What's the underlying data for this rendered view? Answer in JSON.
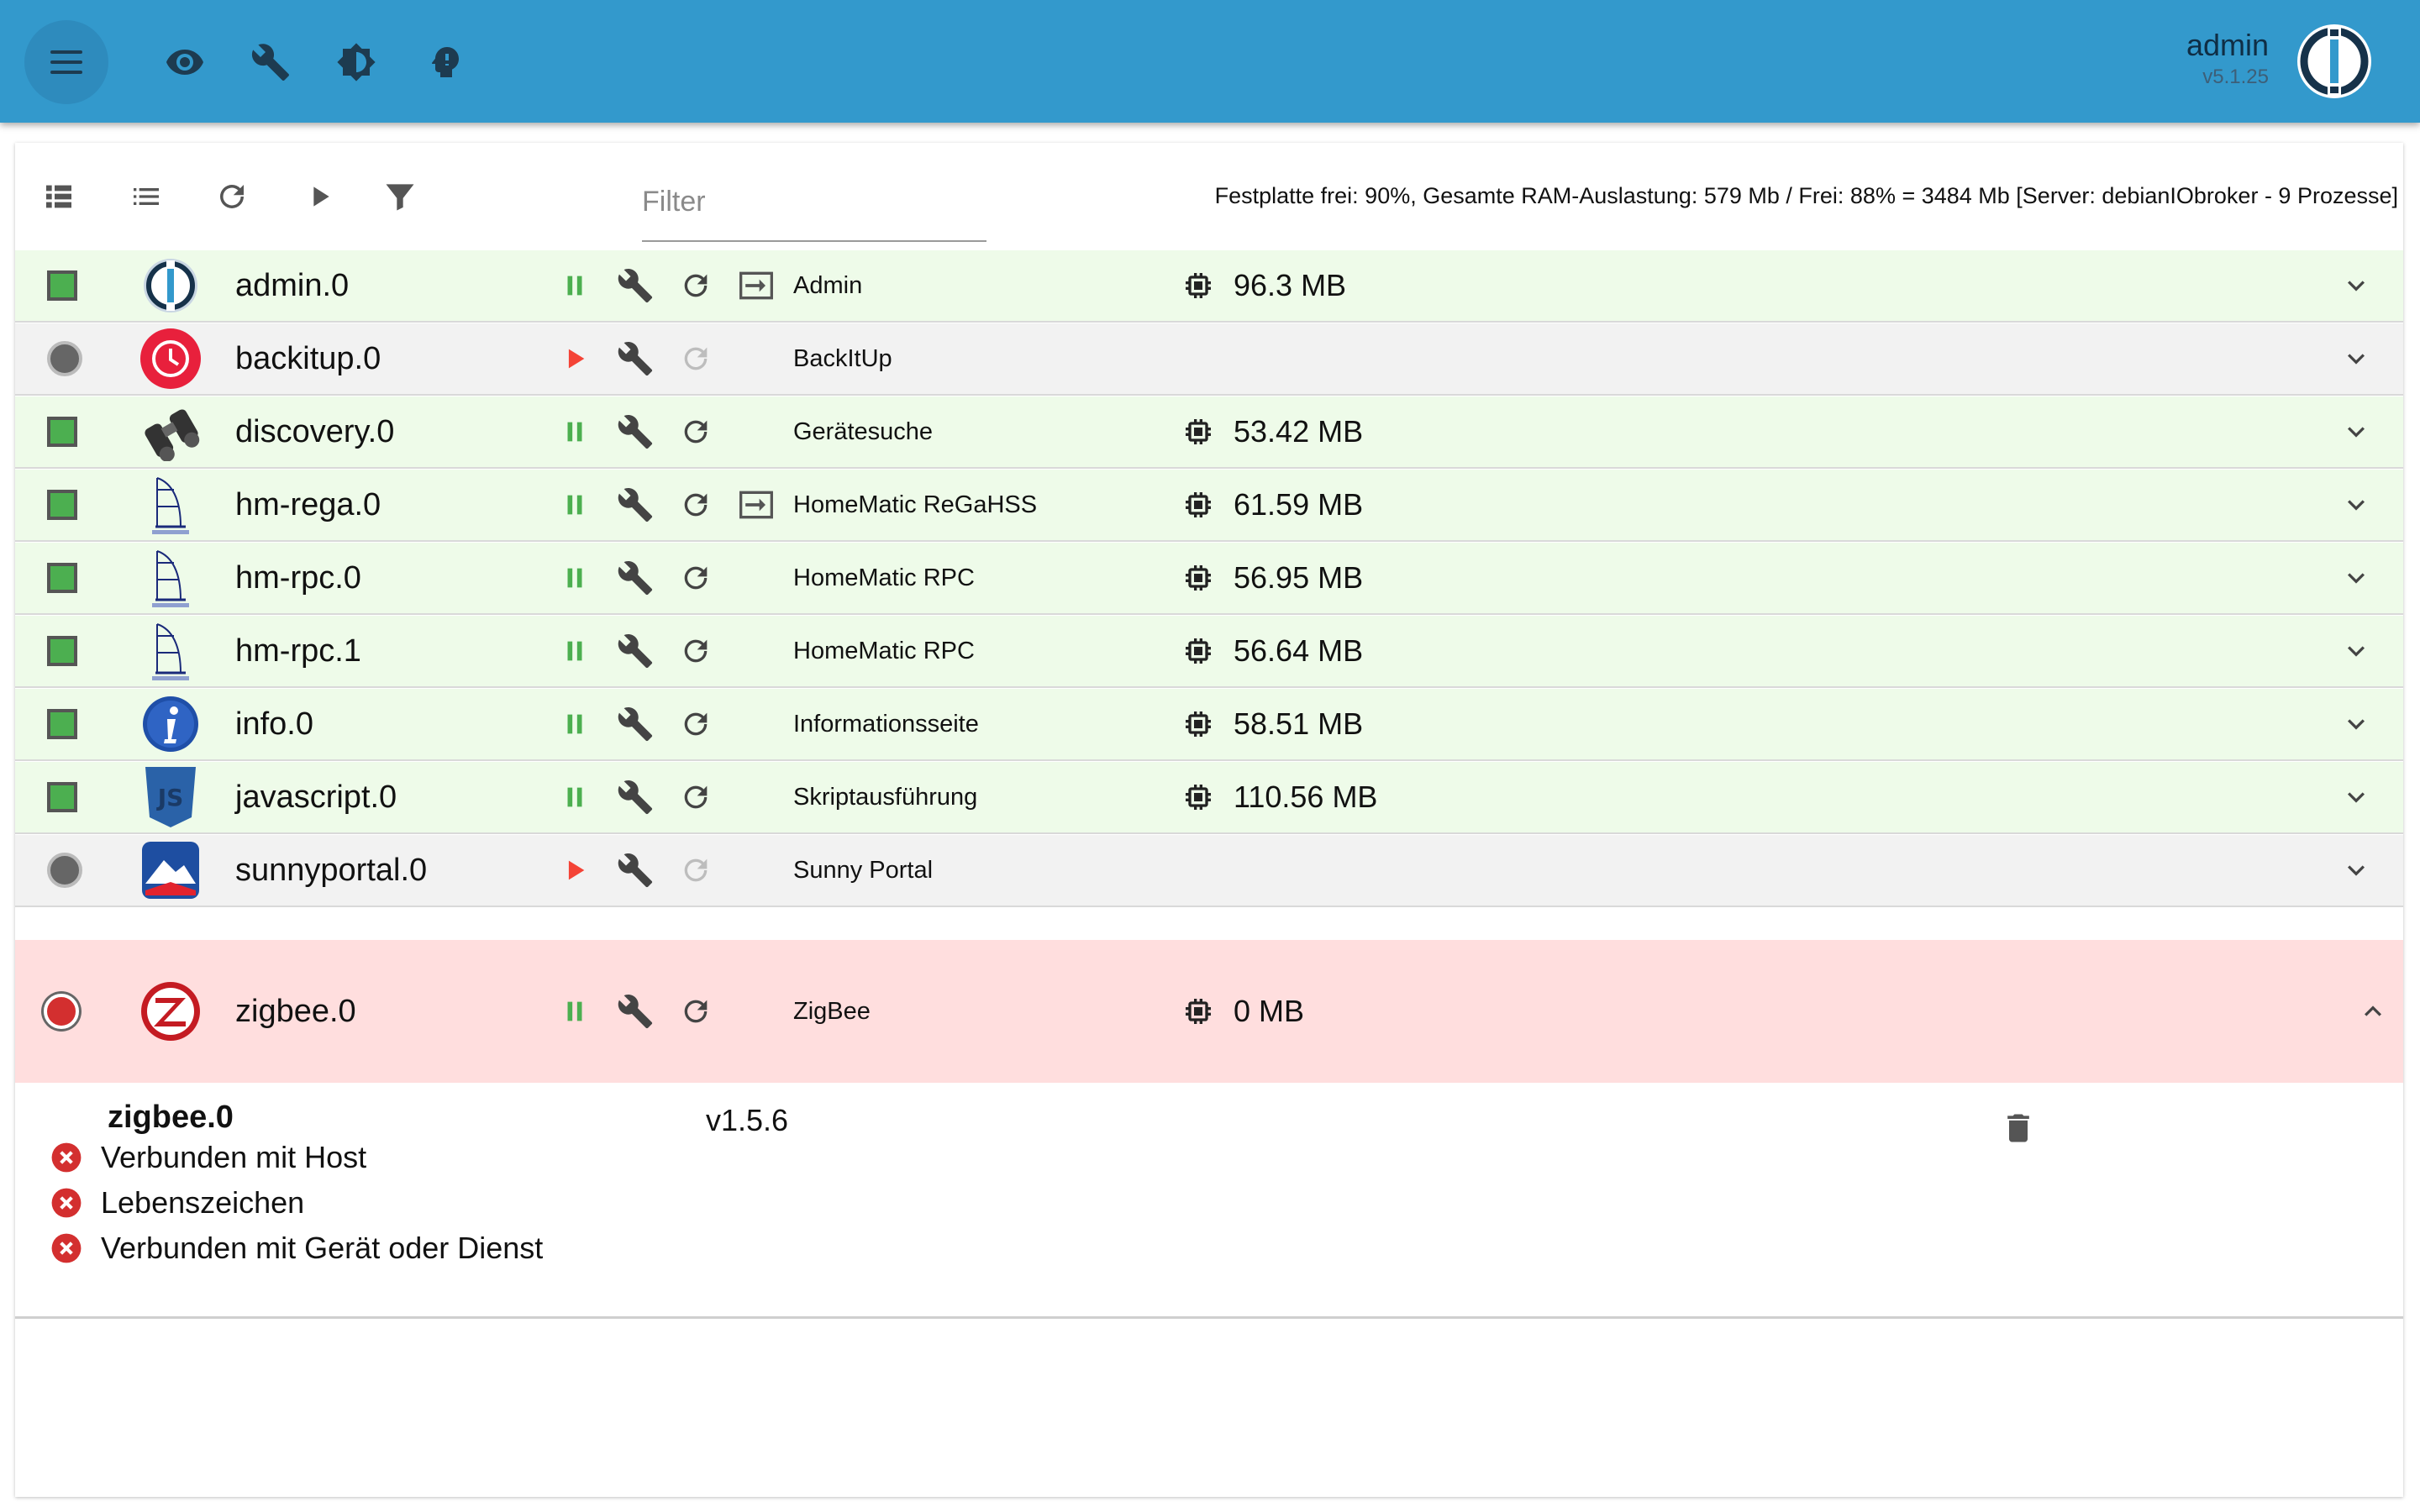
{
  "user": {
    "name": "admin",
    "version": "v5.1.25"
  },
  "toolbar": {
    "filter_placeholder": "Filter",
    "system_info": "Festplatte frei: 90%, Gesamte RAM-Auslastung: 579 Mb / Frei: 88% = 3484 Mb [Server: debianIObroker - 9 Prozesse]"
  },
  "instances": [
    {
      "name": "admin.0",
      "title": "Admin",
      "memory": "96.3 MB",
      "state": "running",
      "icon": "admin-logo-icon",
      "link": true
    },
    {
      "name": "backitup.0",
      "title": "BackItUp",
      "memory": "",
      "state": "stopped",
      "icon": "backitup-icon",
      "link": false
    },
    {
      "name": "discovery.0",
      "title": "Gerätesuche",
      "memory": "53.42 MB",
      "state": "running",
      "icon": "binoculars-icon",
      "link": false
    },
    {
      "name": "hm-rega.0",
      "title": "HomeMatic ReGaHSS",
      "memory": "61.59 MB",
      "state": "running",
      "icon": "homematic-icon",
      "link": true
    },
    {
      "name": "hm-rpc.0",
      "title": "HomeMatic RPC",
      "memory": "56.95 MB",
      "state": "running",
      "icon": "homematic-icon",
      "link": false
    },
    {
      "name": "hm-rpc.1",
      "title": "HomeMatic RPC",
      "memory": "56.64 MB",
      "state": "running",
      "icon": "homematic-icon",
      "link": false
    },
    {
      "name": "info.0",
      "title": "Informationsseite",
      "memory": "58.51 MB",
      "state": "running",
      "icon": "info-icon",
      "link": false
    },
    {
      "name": "javascript.0",
      "title": "Skriptausführung",
      "memory": "110.56 MB",
      "state": "running",
      "icon": "javascript-icon",
      "link": false
    },
    {
      "name": "sunnyportal.0",
      "title": "Sunny Portal",
      "memory": "",
      "state": "stopped",
      "icon": "sunnyportal-icon",
      "link": false
    }
  ],
  "expanded": {
    "name": "zigbee.0",
    "title": "ZigBee",
    "memory": "0 MB",
    "version": "v1.5.6",
    "checks": [
      "Verbunden mit Host",
      "Lebenszeichen",
      "Verbunden mit Gerät oder Dienst"
    ]
  },
  "colors": {
    "appbar": "#3399cc",
    "running_row": "#eefbe9",
    "stopped_row": "#f2f2f2",
    "error_row": "#ffdede",
    "pause_green": "#4caf50",
    "play_red": "#f44336"
  }
}
